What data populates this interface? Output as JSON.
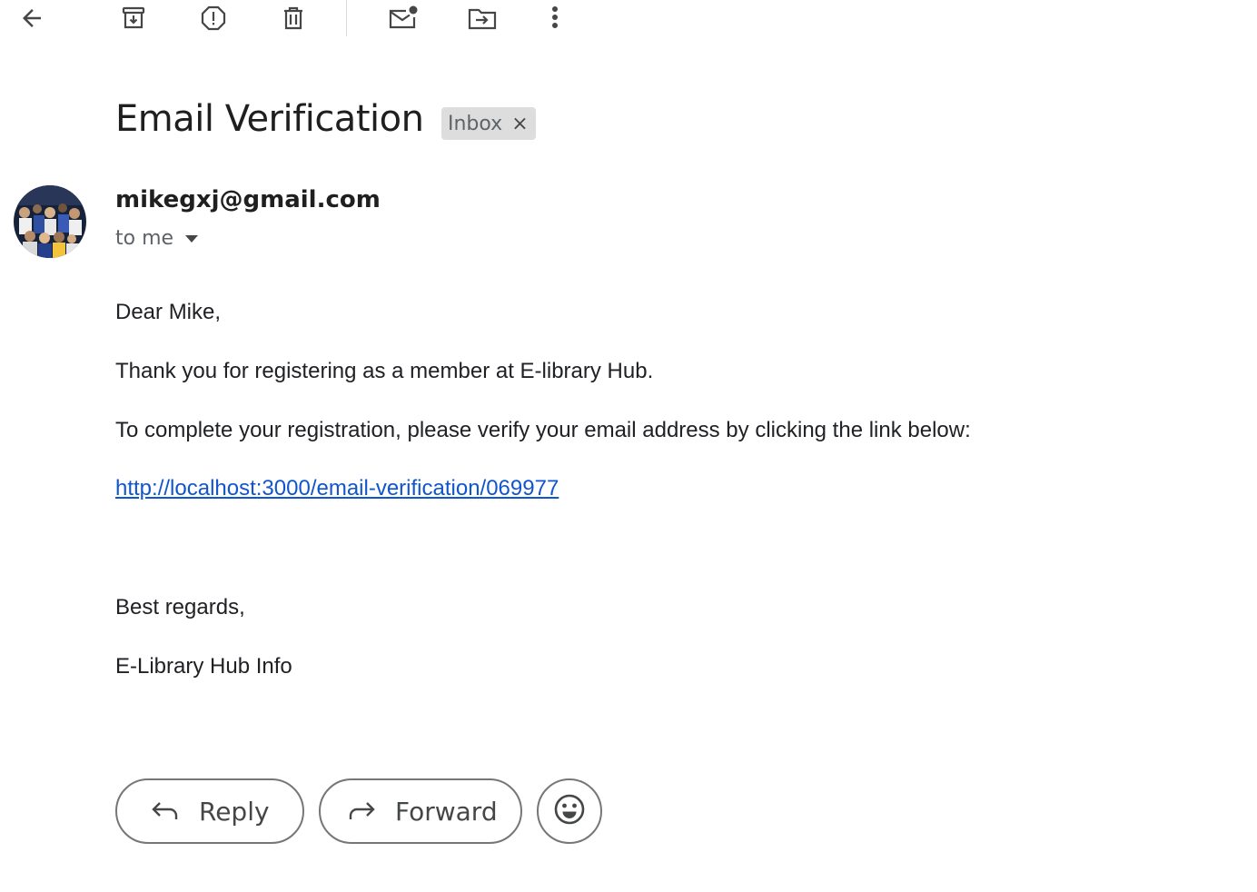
{
  "toolbar": {
    "back_icon": "arrow-left-icon",
    "archive_icon": "archive-icon",
    "spam_icon": "report-spam-icon",
    "delete_icon": "trash-icon",
    "mark_unread_icon": "mark-unread-icon",
    "move_icon": "move-to-folder-icon",
    "more_icon": "more-vert-icon"
  },
  "message": {
    "subject": "Email Verification",
    "label": "Inbox",
    "label_remove": "×",
    "sender": "mikegxj@gmail.com",
    "recipient": "to me",
    "body": {
      "greeting": "Dear Mike,",
      "line1": "Thank you for registering as a member at E-library Hub.",
      "line2": "To complete your registration, please verify your email address by clicking the link below:",
      "link": "http://localhost:3000/email-verification/069977",
      "closing": "Best regards,",
      "signature": "E-Library Hub Info"
    }
  },
  "actions": {
    "reply_label": "Reply",
    "forward_label": "Forward",
    "emoji_icon": "smiley-icon"
  },
  "colors": {
    "link": "#1155cc",
    "text": "#202124",
    "muted": "#5f6368",
    "chip_bg": "#dddddd",
    "button_border": "#747775"
  }
}
